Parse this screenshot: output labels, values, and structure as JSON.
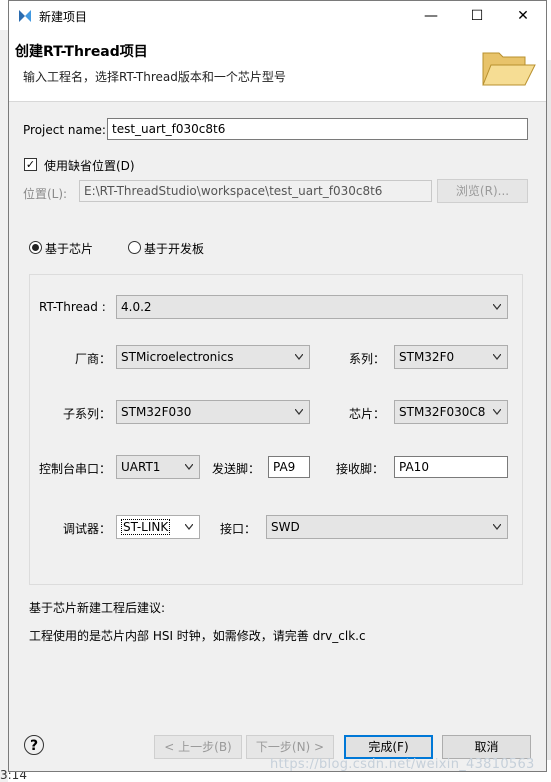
{
  "window": {
    "title": "新建项目",
    "minimize": "—",
    "maximize": "☐",
    "close": "✕"
  },
  "header": {
    "title": "创建RT-Thread项目",
    "description": "输入工程名，选择RT-Thread版本和一个芯片型号",
    "icon": "open-folder-icon"
  },
  "project": {
    "name_label": "Project name:",
    "name_value": "test_uart_f030c8t6",
    "use_default_location_label": "使用缺省位置(D)",
    "use_default_location_checked": true,
    "location_label": "位置(L):",
    "location_value": "E:\\RT-ThreadStudio\\workspace\\test_uart_f030c8t6",
    "browse_label": "浏览(R)..."
  },
  "mode": {
    "chip_label": "基于芯片",
    "board_label": "基于开发板",
    "selected": "chip"
  },
  "config": {
    "rtthread_label": "RT-Thread :",
    "rtthread_value": "4.0.2",
    "vendor_label": "厂商：",
    "vendor_value": "STMicroelectronics",
    "series_label": "系列：",
    "series_value": "STM32F0",
    "subseries_label": "子系列：",
    "subseries_value": "STM32F030",
    "chip_label": "芯片：",
    "chip_value": "STM32F030C8",
    "console_label": "控制台串口：",
    "console_value": "UART1",
    "tx_label": "发送脚：",
    "tx_value": "PA9",
    "rx_label": "接收脚：",
    "rx_value": "PA10",
    "debugger_label": "调试器：",
    "debugger_value": "ST-LINK",
    "interface_label": "接口：",
    "interface_value": "SWD"
  },
  "suggestion": {
    "title": "基于芯片新建工程后建议:",
    "text": "工程使用的是芯片内部 HSI 时钟，如需修改，请完善 drv_clk.c"
  },
  "footer": {
    "help": "?",
    "back_label": "< 上一步(B)",
    "next_label": "下一步(N) >",
    "finish_label": "完成(F)",
    "cancel_label": "取消"
  },
  "background": {
    "bottom_text": "3:14",
    "watermark": "https://blog.csdn.net/weixin_43810563"
  },
  "colors": {
    "dialog_bg": "#f0f0f0",
    "header_bg": "#ffffff",
    "focus_border": "#0078d7"
  }
}
